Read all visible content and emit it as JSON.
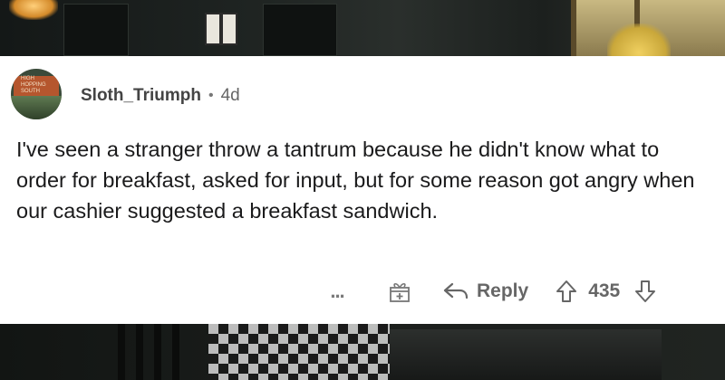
{
  "comment": {
    "username": "Sloth_Triumph",
    "separator": "•",
    "age": "4d",
    "text": "I've seen a stranger throw a tantrum because he didn't know what to order for breakfast, asked for input, but for some reason got angry when our cashier suggested a breakfast sandwich.",
    "avatar_sign_text": "HIGH HOPPING SOUTH",
    "score": "435"
  },
  "actions": {
    "more_label": "...",
    "reply_label": "Reply"
  },
  "icons": {
    "more": "more-options-icon",
    "award": "award-gift-icon",
    "reply": "reply-arrow-icon",
    "upvote": "upvote-arrow-icon",
    "downvote": "downvote-arrow-icon"
  },
  "colors": {
    "card_bg": "#ffffff",
    "text": "#1a1a1b",
    "muted": "#666666"
  }
}
